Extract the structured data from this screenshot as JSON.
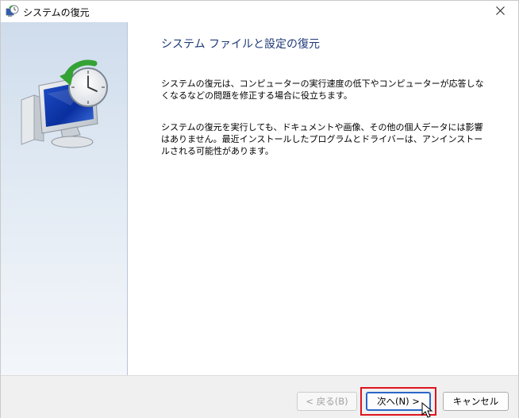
{
  "window": {
    "title": "システムの復元",
    "title_icon": "system-restore-icon",
    "close_icon": "close-icon"
  },
  "side_panel": {
    "hero_icon": "system-restore-computer-clock-icon"
  },
  "main": {
    "heading": "システム ファイルと設定の復元",
    "paragraph1": "システムの復元は、コンピューターの実行速度の低下やコンピューターが応答しなくなるなどの問題を修正する場合に役立ちます。",
    "paragraph2": "システムの復元を実行しても、ドキュメントや画像、その他の個人データには影響はありません。最近インストールしたプログラムとドライバーは、アンインストールされる可能性があります。"
  },
  "footer": {
    "back_label": "< 戻る(B)",
    "next_label": "次へ(N) >",
    "cancel_label": "キャンセル"
  },
  "colors": {
    "heading": "#1e3a78",
    "highlight": "#e0141e",
    "focus_border": "#2a66c8"
  }
}
